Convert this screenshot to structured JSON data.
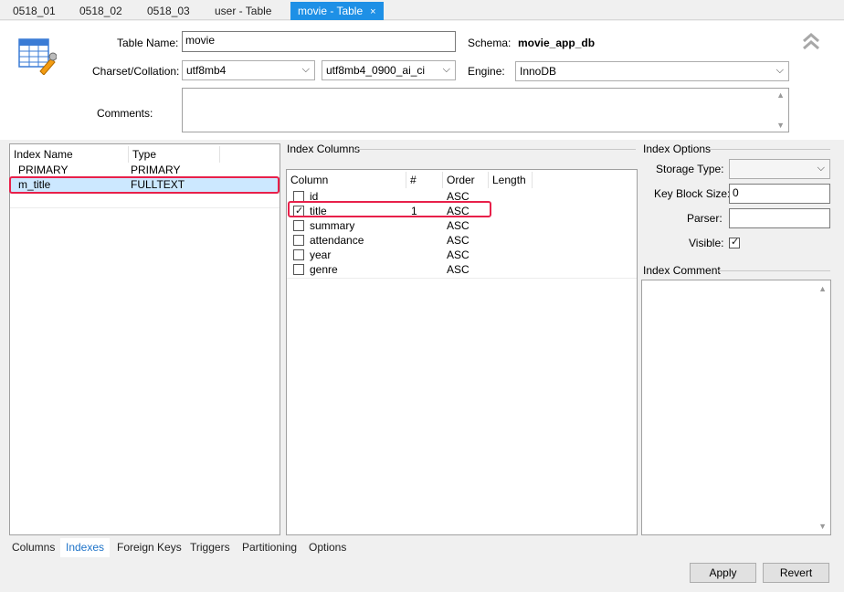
{
  "tabs": [
    {
      "label": "0518_01"
    },
    {
      "label": "0518_02"
    },
    {
      "label": "0518_03"
    },
    {
      "label": "user - Table"
    },
    {
      "label": "movie - Table",
      "close": "×"
    }
  ],
  "header": {
    "table_name_label": "Table Name:",
    "table_name_value": "movie",
    "schema_label": "Schema:",
    "schema_value": "movie_app_db",
    "charset_label": "Charset/Collation:",
    "charset_value": "utf8mb4",
    "collation_value": "utf8mb4_0900_ai_ci",
    "engine_label": "Engine:",
    "engine_value": "InnoDB",
    "comments_label": "Comments:"
  },
  "indexes": {
    "columns": [
      "Index Name",
      "Type"
    ],
    "rows": [
      {
        "name": "PRIMARY",
        "type": "PRIMARY"
      },
      {
        "name": "m_title",
        "type": "FULLTEXT"
      }
    ]
  },
  "index_columns": {
    "title": "Index Columns",
    "headers": [
      "Column",
      "#",
      "Order",
      "Length"
    ],
    "rows": [
      {
        "column": "id",
        "num": "",
        "order": "ASC",
        "length": "",
        "checked": false
      },
      {
        "column": "title",
        "num": "1",
        "order": "ASC",
        "length": "",
        "checked": true
      },
      {
        "column": "summary",
        "num": "",
        "order": "ASC",
        "length": "",
        "checked": false
      },
      {
        "column": "attendance",
        "num": "",
        "order": "ASC",
        "length": "",
        "checked": false
      },
      {
        "column": "year",
        "num": "",
        "order": "ASC",
        "length": "",
        "checked": false
      },
      {
        "column": "genre",
        "num": "",
        "order": "ASC",
        "length": "",
        "checked": false
      }
    ]
  },
  "index_options": {
    "title": "Index Options",
    "storage_type_label": "Storage Type:",
    "storage_type_value": "",
    "key_block_label": "Key Block Size:",
    "key_block_value": "0",
    "parser_label": "Parser:",
    "parser_value": "",
    "visible_label": "Visible:",
    "visible_checked": true,
    "comment_title": "Index Comment"
  },
  "bottom_tabs": [
    "Columns",
    "Indexes",
    "Foreign Keys",
    "Triggers",
    "Partitioning",
    "Options"
  ],
  "buttons": {
    "apply": "Apply",
    "revert": "Revert"
  },
  "colors": {
    "accent": "#1e90e6",
    "highlight": "#e8204a",
    "selected_row": "#cce8ff"
  }
}
